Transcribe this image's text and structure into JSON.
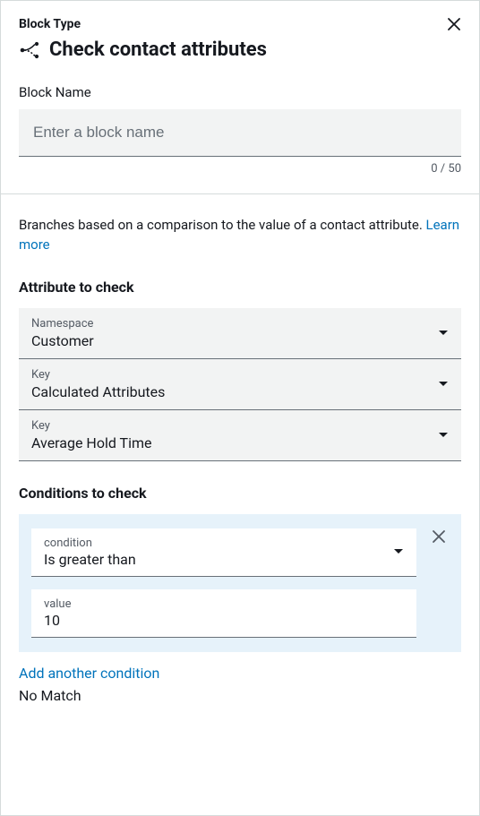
{
  "header": {
    "block_type_label": "Block Type",
    "title": "Check contact attributes"
  },
  "name": {
    "label": "Block Name",
    "placeholder": "Enter a block name",
    "value": "",
    "counter": "0 / 50"
  },
  "description": {
    "text": "Branches based on a comparison to the value of a contact attribute. ",
    "learn_more": "Learn more"
  },
  "attr": {
    "heading": "Attribute to check",
    "items": [
      {
        "label": "Namespace",
        "value": "Customer"
      },
      {
        "label": "Key",
        "value": "Calculated Attributes"
      },
      {
        "label": "Key",
        "value": "Average Hold Time"
      }
    ]
  },
  "conditions": {
    "heading": "Conditions to check",
    "item": {
      "condition_label": "condition",
      "condition_value": "Is greater than",
      "value_label": "value",
      "value_value": "10"
    },
    "add_label": "Add another condition",
    "nomatch_label": "No Match"
  }
}
